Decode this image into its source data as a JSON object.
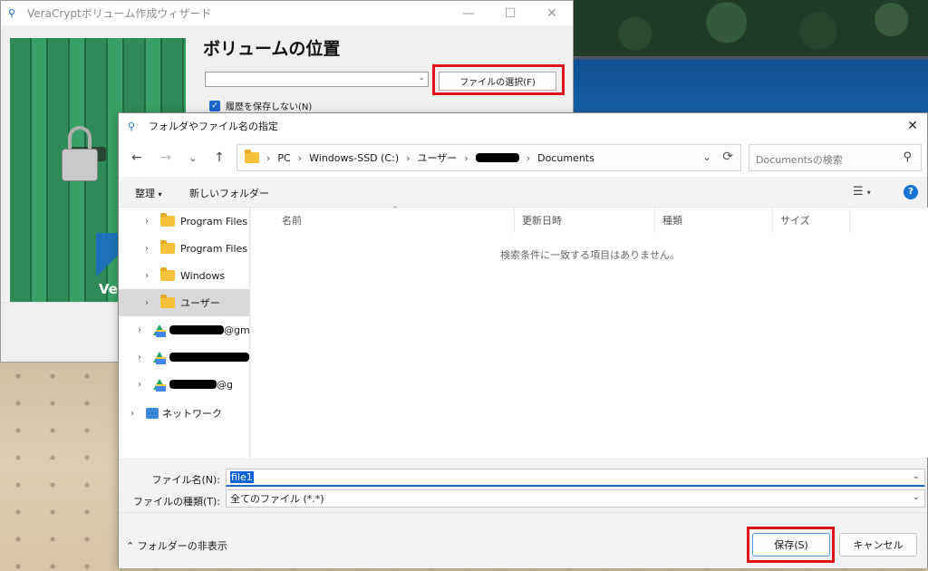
{
  "wizard": {
    "title": "VeraCryptボリューム作成ウィザード",
    "heading": "ボリュームの位置",
    "select_file_button": "ファイルの選択(F)",
    "no_history_checkbox": "履歴を保存しない(N)",
    "brand_text": "Ve"
  },
  "dialog": {
    "title": "フォルダやファイル名の指定",
    "breadcrumb": [
      "PC",
      "Windows-SSD (C:)",
      "ユーザー",
      "Documents"
    ],
    "search_placeholder": "Documentsの検索",
    "toolbar": {
      "organize": "整理",
      "new_folder": "新しいフォルダー"
    },
    "tree": [
      {
        "label": "Program Files",
        "type": "folder",
        "expanded": false,
        "selected": false
      },
      {
        "label": "Program Files",
        "type": "folder",
        "expanded": false,
        "selected": false
      },
      {
        "label": "Windows",
        "type": "folder",
        "expanded": false,
        "selected": false
      },
      {
        "label": "ユーザー",
        "type": "folder",
        "expanded": false,
        "selected": true
      },
      {
        "label": "@gm",
        "type": "gdrive"
      },
      {
        "label": "",
        "type": "gdrive"
      },
      {
        "label": "@g",
        "type": "gdrive"
      },
      {
        "label": "ネットワーク",
        "type": "network"
      }
    ],
    "columns": [
      "名前",
      "更新日時",
      "種類",
      "サイズ"
    ],
    "empty_message": "検索条件に一致する項目はありません。",
    "filename_label": "ファイル名(N):",
    "filename_value": "file1",
    "filetype_label": "ファイルの種類(T):",
    "filetype_value": "全てのファイル (*.*)",
    "hide_folders": "フォルダーの非表示",
    "save_button": "保存(S)",
    "cancel_button": "キャンセル"
  },
  "colors": {
    "highlight": "#e0141c",
    "accent": "#1a66cc",
    "folder": "#f3c13a"
  }
}
